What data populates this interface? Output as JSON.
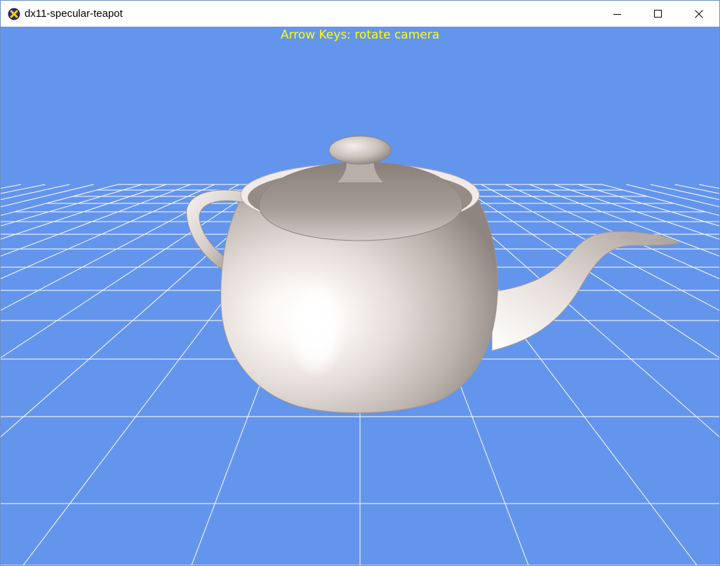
{
  "window": {
    "title": "dx11-specular-teapot",
    "icon": "app-x-icon",
    "controls": [
      "minimize-icon",
      "maximize-icon",
      "close-icon"
    ]
  },
  "viewport": {
    "background_color": "#6495ED",
    "grid_color": "#FFFFFF",
    "overlay_text": "Arrow Keys: rotate camera",
    "overlay_color": "#FFFF00",
    "object": "teapot",
    "object_color": "#EDE6E2"
  }
}
